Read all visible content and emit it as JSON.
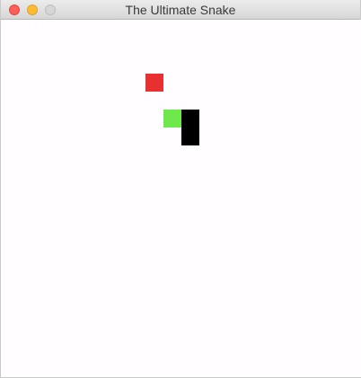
{
  "window": {
    "title": "The Ultimate Snake",
    "buttons": [
      "close",
      "minimize",
      "zoom"
    ]
  },
  "game": {
    "grid_cell": "20px blocks",
    "food": {
      "color": "#e83030",
      "col": 8,
      "row": 3
    },
    "snake": {
      "head": {
        "color": "#6ee84a",
        "col": 9,
        "row": 5
      },
      "body_color": "#000000",
      "body": [
        {
          "col": 10,
          "row": 5
        },
        {
          "col": 10,
          "row": 6
        }
      ]
    }
  }
}
